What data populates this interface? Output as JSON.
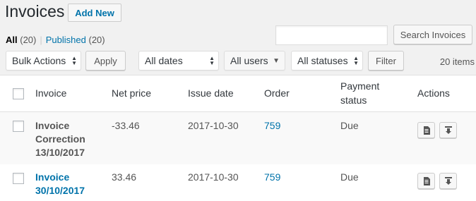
{
  "header": {
    "title": "Invoices",
    "add_new_label": "Add New"
  },
  "views": {
    "all_label": "All",
    "all_count": "(20)",
    "separator": "|",
    "published_label": "Published",
    "published_count": "(20)"
  },
  "search": {
    "value": "",
    "button_label": "Search Invoices"
  },
  "filters": {
    "bulk_actions": "Bulk Actions",
    "apply_label": "Apply",
    "dates": "All dates",
    "users": "All users",
    "statuses": "All statuses",
    "filter_label": "Filter",
    "items_count": "20 items"
  },
  "table": {
    "columns": {
      "invoice": "Invoice",
      "net_price": "Net price",
      "issue_date": "Issue date",
      "order": "Order",
      "payment_status_line1": "Payment",
      "payment_status_line2": "status",
      "actions": "Actions"
    },
    "rows": [
      {
        "invoice_line1": "Invoice",
        "invoice_line2": "Correction",
        "invoice_line3": "13/10/2017",
        "net_price": "-33.46",
        "issue_date": "2017-10-30",
        "order": "759",
        "payment_status": "Due"
      },
      {
        "invoice_line1": "Invoice",
        "invoice_line2": "30/10/2017",
        "net_price": "33.46",
        "issue_date": "2017-10-30",
        "order": "759",
        "payment_status": "Due"
      }
    ]
  },
  "icons": {
    "view_document": "document-icon",
    "download": "download-icon"
  },
  "colors": {
    "link": "#0073aa",
    "background": "#f1f1f1",
    "table": "#ffffff"
  }
}
